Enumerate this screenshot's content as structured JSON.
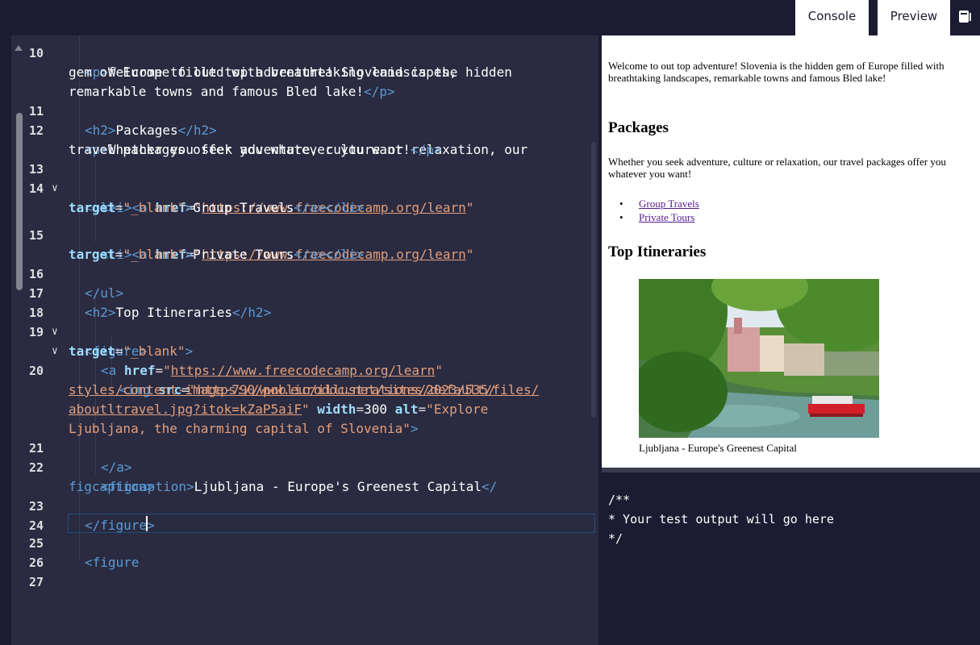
{
  "tabs": {
    "console_label": "Console",
    "preview_label": "Preview"
  },
  "editor": {
    "lines": [
      {
        "num": "10",
        "fold": false
      },
      {
        "num": "11",
        "fold": false
      },
      {
        "num": "12",
        "fold": false
      },
      {
        "num": "13",
        "fold": true
      },
      {
        "num": "14",
        "fold": false
      },
      {
        "num": "15",
        "fold": false
      },
      {
        "num": "16",
        "fold": false
      },
      {
        "num": "17",
        "fold": false
      },
      {
        "num": "18",
        "fold": true
      },
      {
        "num": "19",
        "fold": true
      },
      {
        "num": "20",
        "fold": false
      },
      {
        "num": "21",
        "fold": false
      },
      {
        "num": "22",
        "fold": false
      },
      {
        "num": "23",
        "fold": false
      },
      {
        "num": "24",
        "fold": false
      },
      {
        "num": "25",
        "fold": false
      },
      {
        "num": "26",
        "fold": false
      },
      {
        "num": "27",
        "fold": false
      }
    ],
    "fold_glyph": "∨",
    "code": {
      "l10_cut": "<p>Welcome to out top adventure! Slovenia is the hidden",
      "l10a": "gem of Europe filled with breathtaking landscapes,",
      "l10b_text": "remarkable towns and famous Bled lake!",
      "l11_text": "Packages",
      "l12_text": "Whether you seek adventure, culture or relaxation, our",
      "l12b_text": "travel packages offer you whatever you want!",
      "href_attr": "href",
      "target_attr": "target",
      "src_attr": "src",
      "width_attr": "width",
      "alt_attr": "alt",
      "url_learn": "https://www.freecodecamp.org/learn",
      "target_val": "_blank",
      "link1_text": "Group Travels",
      "link2_text": "Private Tours",
      "l17_text": "Top Itineraries",
      "img_url_1": "https://www.eurodoc.net/sites/default/files/",
      "img_url_2": "styles/content-image-790/public/illustrations/2023/535/",
      "img_url_3": "aboutltravel.jpg?itok=kZaP5aiF",
      "width_val": "300",
      "alt_val_1": "Explore",
      "alt_val_2": "Ljubljana, the charming capital of Slovenia",
      "caption_text": "Ljubljana - Europe's Greenest Capital",
      "tag_p": "p",
      "tag_h2": "h2",
      "tag_ul": "ul",
      "tag_li": "li",
      "tag_a": "a",
      "tag_figure": "figure",
      "tag_img": "img",
      "tag_figcaption": "figcaption",
      "typed": "figure"
    }
  },
  "preview": {
    "intro": "Welcome to out top adventure! Slovenia is the hidden gem of Europe filled with breathtaking landscapes, remarkable towns and famous Bled lake!",
    "packages_heading": "Packages",
    "packages_text": "Whether you seek adventure, culture or relaxation, our travel packages offer you whatever you want!",
    "links": [
      "Group Travels",
      "Private Tours"
    ],
    "itineraries_heading": "Top Itineraries",
    "caption": "Ljubljana - Europe's Greenest Capital"
  },
  "console": {
    "line1": "/**",
    "line2": "* Your test output will go here",
    "line3": "*/"
  },
  "colors": {
    "editor_bg": "#2a2a40",
    "tag": "#5b9bd5",
    "attr": "#9cdcfe",
    "string": "#e2a07d",
    "console_bg": "#1b1b32"
  }
}
